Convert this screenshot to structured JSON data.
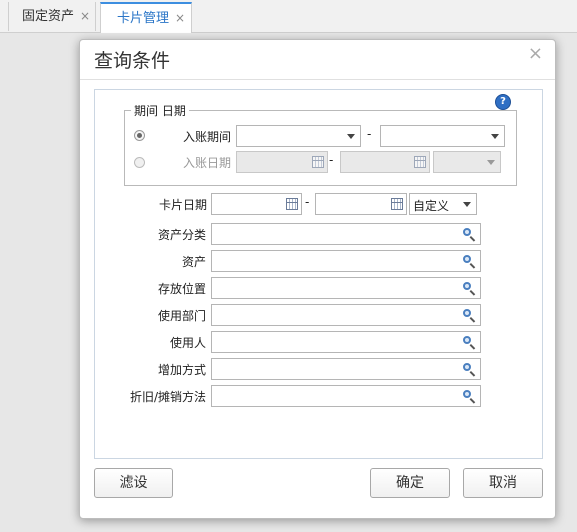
{
  "tabs": [
    {
      "label": "固定资产",
      "close": "×"
    },
    {
      "label": "卡片管理",
      "close": "×"
    }
  ],
  "dialog": {
    "title": "查询条件",
    "close": "×",
    "help": "?",
    "period_group": {
      "legend": "期间 日期",
      "accounting_period_label": "入账期间",
      "accounting_period_from": "",
      "accounting_period_to": "",
      "accounting_date_label": "入账日期",
      "accounting_date_from": "",
      "accounting_date_to": "",
      "accounting_date_range": "",
      "selected": "入账期间"
    },
    "dash": "-",
    "card_date": {
      "label": "卡片日期",
      "from": "",
      "to": "",
      "range": "自定义"
    },
    "fields": [
      {
        "label": "资产分类",
        "value": ""
      },
      {
        "label": "资产",
        "value": ""
      },
      {
        "label": "存放位置",
        "value": ""
      },
      {
        "label": "使用部门",
        "value": ""
      },
      {
        "label": "使用人",
        "value": ""
      },
      {
        "label": "增加方式",
        "value": ""
      },
      {
        "label": "折旧/摊销方法",
        "value": ""
      }
    ],
    "buttons": {
      "filter": "滤设",
      "ok": "确定",
      "cancel": "取消"
    }
  }
}
